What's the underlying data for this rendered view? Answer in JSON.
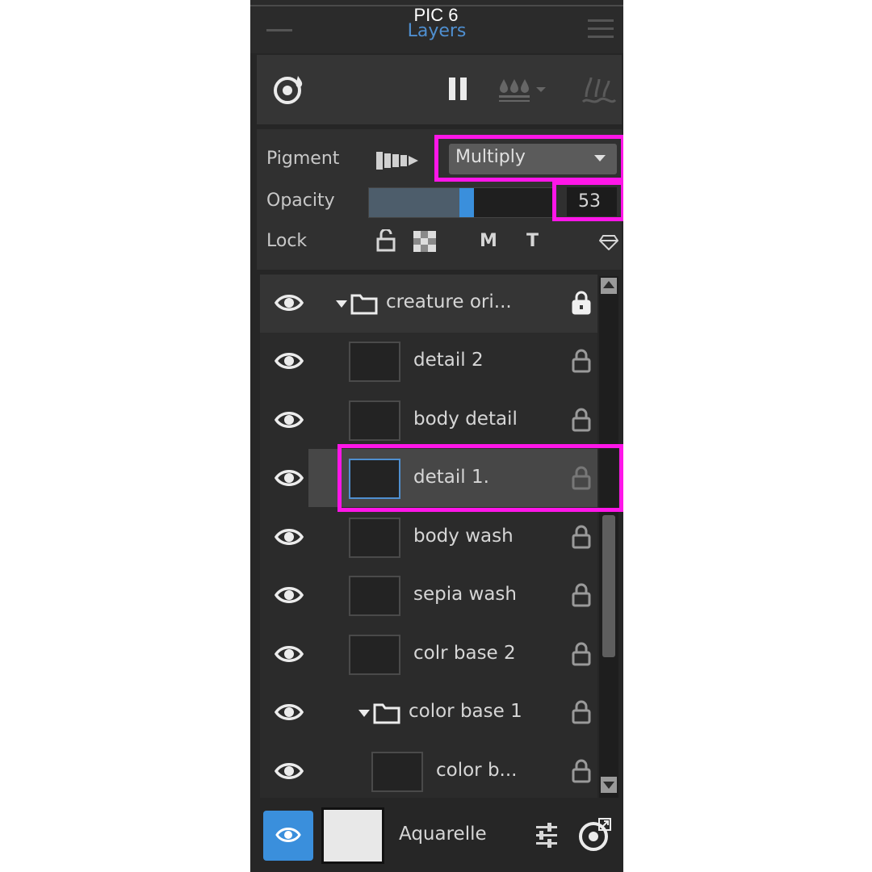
{
  "caption": "PIC 6",
  "panel": {
    "title": "Layers"
  },
  "toolbar": {
    "icons": [
      "wet-layer-icon",
      "pause-icon",
      "drops-dropdown-icon",
      "water-splash-icon"
    ]
  },
  "properties": {
    "pigment_label": "Pigment",
    "blend_mode": "Multiply",
    "opacity_label": "Opacity",
    "opacity_value": "53",
    "opacity_fraction": 0.53,
    "lock_label": "Lock",
    "lock_m": "M",
    "lock_t": "T"
  },
  "layers": [
    {
      "name": "creature ori...",
      "type": "group"
    },
    {
      "name": "detail 2",
      "type": "layer"
    },
    {
      "name": "body detail",
      "type": "layer"
    },
    {
      "name": "detail 1.",
      "type": "layer",
      "selected": true
    },
    {
      "name": "body wash",
      "type": "layer"
    },
    {
      "name": "sepia wash",
      "type": "layer"
    },
    {
      "name": "colr base 2",
      "type": "layer"
    },
    {
      "name": "color base 1",
      "type": "group"
    },
    {
      "name": "color b...",
      "type": "layer"
    }
  ],
  "footer": {
    "brush_name": "Aquarelle"
  },
  "colors": {
    "accent": "#3a8fdc",
    "highlight": "#ff16e8",
    "panel_bg": "#262626"
  }
}
